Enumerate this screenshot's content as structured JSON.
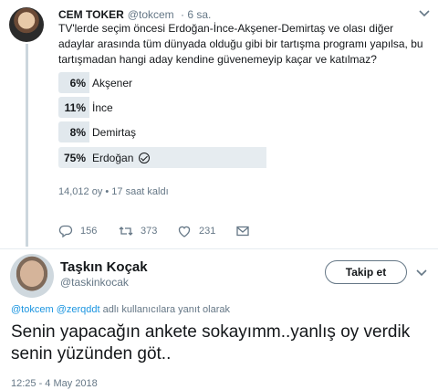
{
  "tweet1": {
    "name": "CEM TOKER",
    "handle": "@tokcem",
    "time": "· 6 sa.",
    "text": "TV'lerde seçim öncesi Erdoğan-İnce-Akşener-Demirtaş ve olası diğer adaylar arasında tüm dünyada olduğu gibi bir tartışma programı yapılsa, bu tartışmadan hangi aday kendine güvenemeyip kaçar ve katılmaz?",
    "poll": [
      {
        "pct": "6%",
        "label": "Akşener",
        "value": 6,
        "winner": false
      },
      {
        "pct": "11%",
        "label": "İnce",
        "value": 11,
        "winner": false
      },
      {
        "pct": "8%",
        "label": "Demirtaş",
        "value": 8,
        "winner": false
      },
      {
        "pct": "75%",
        "label": "Erdoğan",
        "value": 75,
        "winner": true
      }
    ],
    "poll_meta": "14,012 oy • 17 saat kaldı",
    "actions": {
      "replies": "156",
      "retweets": "373",
      "likes": "231"
    }
  },
  "tweet2": {
    "name": "Taşkın Koçak",
    "handle": "@taskinkocak",
    "follow_label": "Takip et",
    "reply_mention1": "@tokcem",
    "reply_mention2": "@zerqddt",
    "reply_suffix": "adlı kullanıcılara yanıt olarak",
    "text": "Senin yapacağın ankete sokayımm..yanlış oy verdik senin yüzünden göt..",
    "timestamp": "12:25 - 4 May 2018"
  },
  "colors": {
    "text": "#14171a",
    "muted": "#657786",
    "link": "#1b95e0",
    "poll_bar": "#e1e8ed"
  },
  "icons": [
    "reply-icon",
    "retweet-icon",
    "like-icon",
    "dm-icon",
    "chevron-down-icon",
    "check-circle-icon"
  ]
}
